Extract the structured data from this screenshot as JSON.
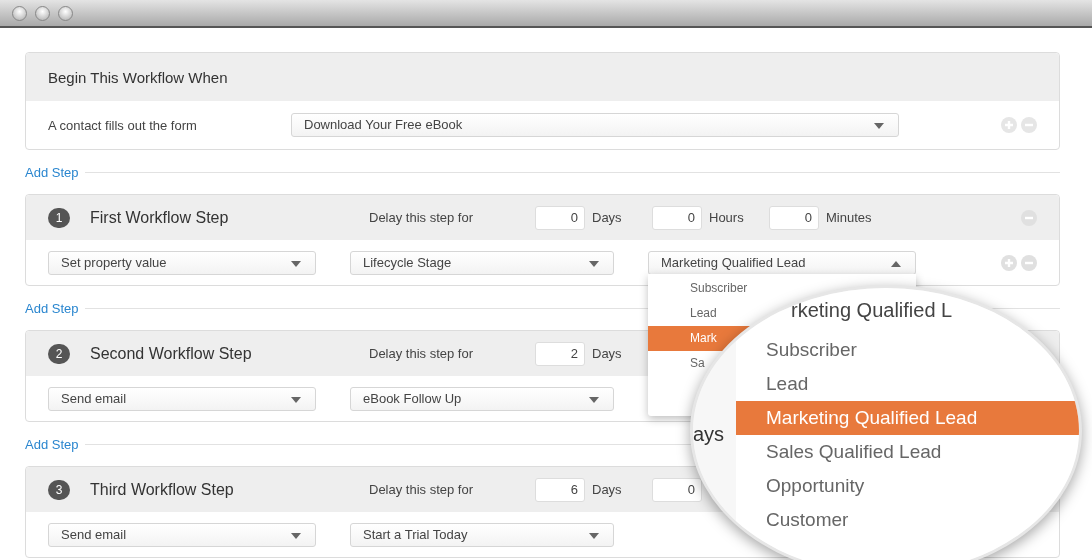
{
  "trigger": {
    "title": "Begin This Workflow When",
    "label": "A contact fills out the form",
    "value": "Download Your Free eBook",
    "row_icons": true
  },
  "steps": [
    {
      "add_step_label": "Add Step",
      "number": "1",
      "title": "First Workflow Step",
      "delay_label": "Delay this step for",
      "header_icon": true,
      "row_icons": true,
      "delays": [
        {
          "value": "0",
          "unit": "Days"
        },
        {
          "value": "0",
          "unit": "Hours"
        },
        {
          "value": "0",
          "unit": "Minutes"
        }
      ],
      "selects": [
        {
          "value": "Set property value",
          "open": false
        },
        {
          "value": "Lifecycle Stage",
          "open": false
        },
        {
          "value": "Marketing Qualified Lead",
          "open": true,
          "options": [
            {
              "label": "Subscriber",
              "selected": false
            },
            {
              "label": "Lead",
              "selected": false
            },
            {
              "label": "Mark",
              "selected": true
            },
            {
              "label": "Sa",
              "selected": false
            }
          ]
        }
      ]
    },
    {
      "add_step_label": "Add Step",
      "number": "2",
      "title": "Second Workflow Step",
      "delay_label": "Delay this step for",
      "delays": [
        {
          "value": "2",
          "unit": "Days"
        }
      ],
      "selects": [
        {
          "value": "Send email",
          "open": false
        },
        {
          "value": "eBook Follow Up",
          "open": false
        }
      ]
    },
    {
      "add_step_label": "Add Step",
      "number": "3",
      "title": "Third Workflow Step",
      "delay_label": "Delay this step for",
      "delays": [
        {
          "value": "6",
          "unit": "Days"
        },
        {
          "value": "0"
        }
      ],
      "selects": [
        {
          "value": "Send email",
          "open": false
        },
        {
          "value": "Start a Trial Today",
          "open": false
        }
      ]
    }
  ],
  "magnifier": {
    "header_fragment": "rketing Qualified L",
    "background_fragment": "ays",
    "options": [
      {
        "label": "Subscriber",
        "selected": false
      },
      {
        "label": "Lead",
        "selected": false
      },
      {
        "label": "Marketing Qualified Lead",
        "selected": true
      },
      {
        "label": "Sales Qualified Lead",
        "selected": false
      },
      {
        "label": "Opportunity",
        "selected": false
      },
      {
        "label": "Customer",
        "selected": false
      }
    ]
  }
}
